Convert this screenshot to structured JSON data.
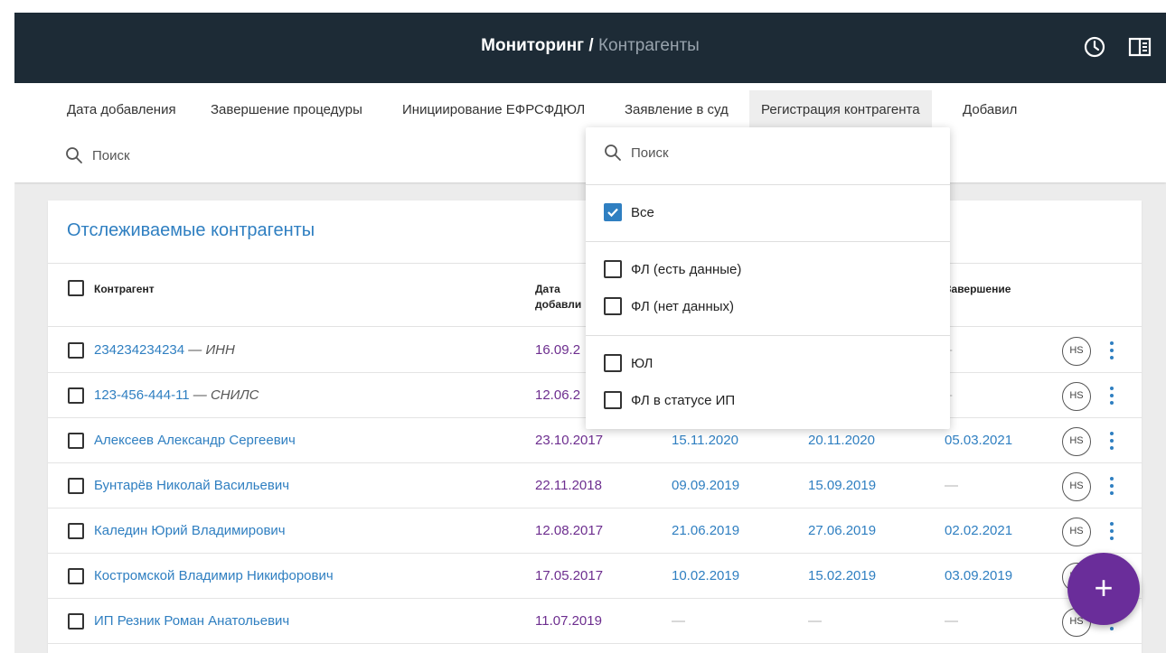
{
  "header": {
    "title_main": "Мониторинг",
    "title_separator": " / ",
    "title_sub": "Контрагенты",
    "icons": [
      "clock-icon",
      "panel-toggle-icon"
    ]
  },
  "filter_tabs": [
    "Дата добавления",
    "Завершение процедуры",
    "Инициирование ЕФРСФДЮЛ",
    "Заявление в суд",
    "Регистрация контрагента",
    "Добавил"
  ],
  "filter_search": {
    "placeholder": "Поиск"
  },
  "card": {
    "title": "Отслеживаемые контрагенты",
    "columns": {
      "contragent": "Контрагент",
      "date_added_line1": "Дата",
      "date_added_line2": "добавли",
      "completion": "Завершение"
    },
    "rows": [
      {
        "name": "234234234234",
        "suffix": " — ИНН",
        "d1": "16.09.2",
        "d2": "",
        "d3": "",
        "d4": "–",
        "badge": "HS"
      },
      {
        "name": "123-456-444-11",
        "suffix": " — СНИЛС",
        "d1": "12.06.2",
        "d2": "",
        "d3": "",
        "d4": "–",
        "badge": "HS"
      },
      {
        "name": "Алексеев Александр Сергеевич",
        "suffix": "",
        "d1": "23.10.2017",
        "d2": "15.11.2020",
        "d3": "20.11.2020",
        "d4": "05.03.2021",
        "badge": "HS"
      },
      {
        "name": "Бунтарёв Николай Васильевич",
        "suffix": "",
        "d1": "22.11.2018",
        "d2": "09.09.2019",
        "d3": "15.09.2019",
        "d4": "—",
        "badge": "HS"
      },
      {
        "name": "Каледин Юрий Владимирович",
        "suffix": "",
        "d1": "12.08.2017",
        "d2": "21.06.2019",
        "d3": "27.06.2019",
        "d4": "02.02.2021",
        "badge": "HS"
      },
      {
        "name": "Костромской Владимир Никифорович",
        "suffix": "",
        "d1": "17.05.2017",
        "d2": "10.02.2019",
        "d3": "15.02.2019",
        "d4": "03.09.2019",
        "badge": "HS"
      },
      {
        "name": "ИП Резник Роман Анатольевич",
        "suffix": "",
        "d1": "11.07.2019",
        "d2": "—",
        "d3": "—",
        "d4": "—",
        "badge": "HS"
      }
    ]
  },
  "dropdown": {
    "search_placeholder": "Поиск",
    "all_label": "Все",
    "all_checked": true,
    "fl_with_data": "ФЛ (есть данные)",
    "fl_no_data": "ФЛ (нет данных)",
    "ul": "ЮЛ",
    "fl_ip": "ФЛ в статусе ИП"
  },
  "fab": {
    "label": "+"
  },
  "colors": {
    "header_bg": "#1d2b36",
    "link": "#2f7fc1",
    "date_added": "#6d2e8f",
    "fab": "#6a2d9a"
  }
}
